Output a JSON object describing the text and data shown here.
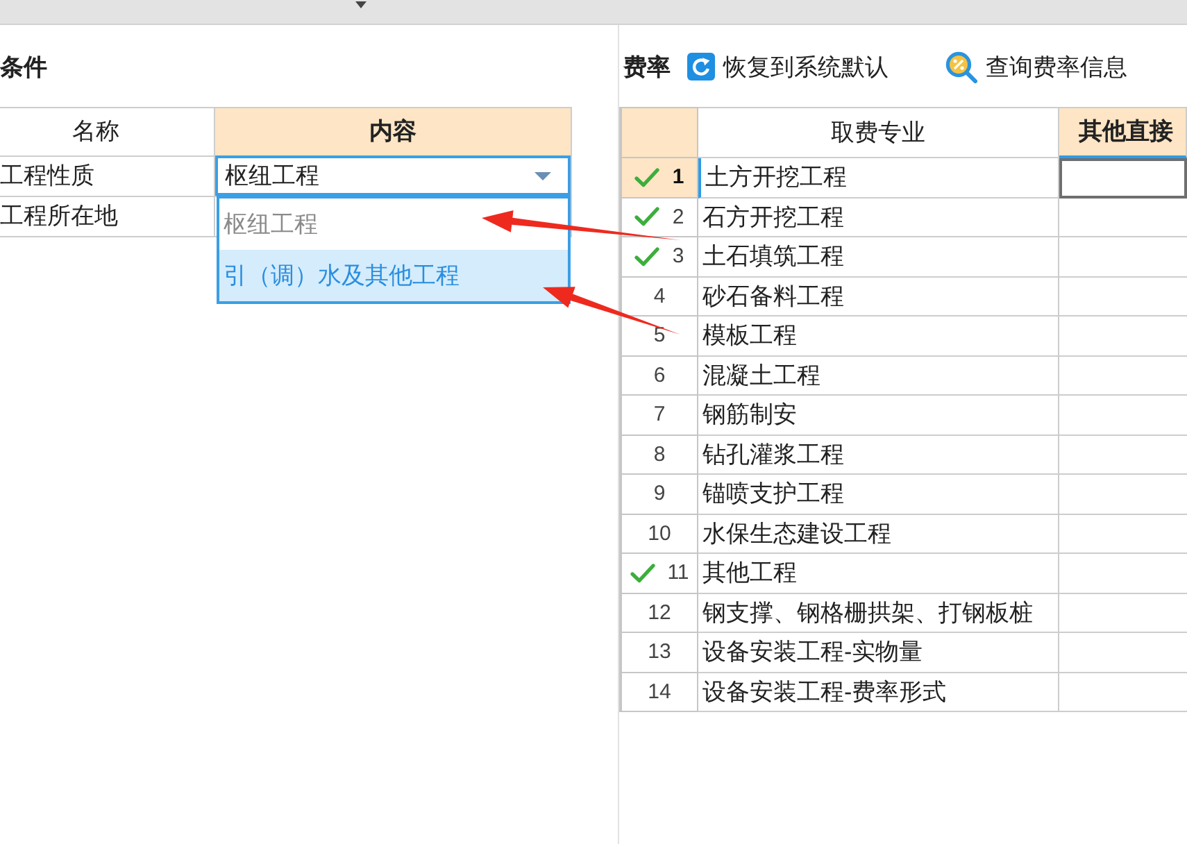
{
  "conditions": {
    "title": "条件",
    "columns": [
      {
        "label": "名称",
        "highlighted": false
      },
      {
        "label": "内容",
        "highlighted": true
      }
    ],
    "rows": [
      {
        "name": "工程性质",
        "value": "枢纽工程",
        "expanded": true
      },
      {
        "name": "工程所在地"
      }
    ],
    "dropdown_options": [
      {
        "label": "枢纽工程",
        "selected": false
      },
      {
        "label": "引（调）水及其他工程",
        "selected": true
      }
    ]
  },
  "rates": {
    "title": "费率",
    "toolbar": [
      {
        "kind": "restore",
        "label": "恢复到系统默认"
      },
      {
        "kind": "query",
        "label": "查询费率信息"
      }
    ],
    "columns": [
      {
        "label": "取费专业",
        "highlighted": false
      },
      {
        "label": "其他直接",
        "highlighted": true
      }
    ],
    "rows": [
      {
        "index": "1",
        "name": "土方开挖工程",
        "checked": true,
        "selected": true
      },
      {
        "index": "2",
        "name": "石方开挖工程",
        "checked": true,
        "selected": false
      },
      {
        "index": "3",
        "name": "土石填筑工程",
        "checked": true,
        "selected": false
      },
      {
        "index": "4",
        "name": "砂石备料工程",
        "checked": false,
        "selected": false
      },
      {
        "index": "5",
        "name": "模板工程",
        "checked": false,
        "selected": false
      },
      {
        "index": "6",
        "name": "混凝土工程",
        "checked": false,
        "selected": false
      },
      {
        "index": "7",
        "name": "钢筋制安",
        "checked": false,
        "selected": false
      },
      {
        "index": "8",
        "name": "钻孔灌浆工程",
        "checked": false,
        "selected": false
      },
      {
        "index": "9",
        "name": "锚喷支护工程",
        "checked": false,
        "selected": false
      },
      {
        "index": "10",
        "name": "水保生态建设工程",
        "checked": false,
        "selected": false
      },
      {
        "index": "11",
        "name": "其他工程",
        "checked": true,
        "selected": false
      },
      {
        "index": "12",
        "name": "钢支撑、钢格栅拱架、打钢板桩",
        "checked": false,
        "selected": false
      },
      {
        "index": "13",
        "name": "设备安装工程-实物量",
        "checked": false,
        "selected": false
      },
      {
        "index": "14",
        "name": "设备安装工程-费率形式",
        "checked": false,
        "selected": false
      }
    ]
  }
}
